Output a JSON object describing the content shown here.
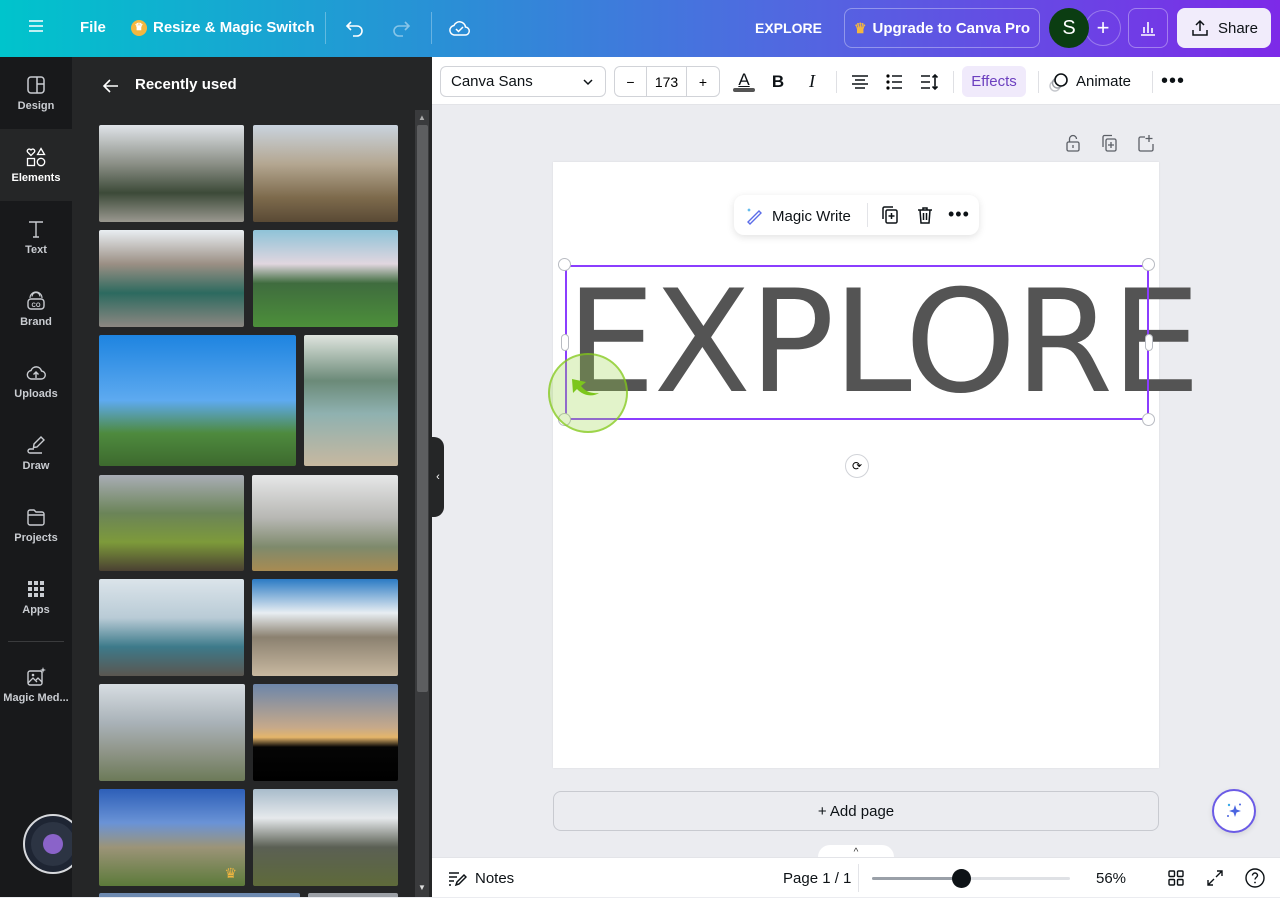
{
  "topbar": {
    "menu_icon": "hamburger-icon",
    "file_label": "File",
    "resize_label": "Resize & Magic Switch",
    "design_title": "EXPLORE",
    "upgrade_label": "Upgrade to Canva Pro",
    "avatar_initial": "S",
    "share_label": "Share",
    "colors": {
      "crown": "#f4b740",
      "avatar_bg": "#0b3d12"
    }
  },
  "rail": {
    "items": [
      {
        "label": "Design",
        "icon": "layout-icon"
      },
      {
        "label": "Elements",
        "icon": "shapes-icon",
        "active": true
      },
      {
        "label": "Text",
        "icon": "text-icon"
      },
      {
        "label": "Brand",
        "icon": "brand-icon"
      },
      {
        "label": "Uploads",
        "icon": "cloud-upload-icon"
      },
      {
        "label": "Draw",
        "icon": "draw-icon"
      },
      {
        "label": "Projects",
        "icon": "folder-icon"
      },
      {
        "label": "Apps",
        "icon": "apps-icon"
      },
      {
        "label": "Magic Med...",
        "icon": "magic-media-icon"
      }
    ]
  },
  "panel": {
    "title": "Recently used",
    "images": [
      {
        "alt": "Hiker in yellow jacket facing snowy mountains and pine trees"
      },
      {
        "alt": "Hiker with trekking pole overlooking rocky mountain valley"
      },
      {
        "alt": "People sitting by a turquoise mountain lake"
      },
      {
        "alt": "Person with open arms facing a volcano over green hills"
      },
      {
        "alt": "Hiker with orange backpack on a rock under blue sky"
      },
      {
        "alt": "Couple sitting on cliff above river canyon"
      },
      {
        "alt": "Couple sitting overlooking green mountain slopes"
      },
      {
        "alt": "Hiker in purple jacket facing misty valley"
      },
      {
        "alt": "Person with binoculars above sea of clouds"
      },
      {
        "alt": "Hiker walking on a dirt road toward snowy peaks"
      },
      {
        "alt": "Person on rocky peak above clouds"
      },
      {
        "alt": "Silhouettes of hikers at sunset"
      },
      {
        "alt": "Group of hikers on rocky trail",
        "premium": true
      },
      {
        "alt": "Hiker with yellow backpack facing snowy mountains"
      }
    ]
  },
  "toolbar": {
    "font_name": "Canva Sans",
    "font_size": "173",
    "decrease_label": "−",
    "increase_label": "+",
    "bold_label": "B",
    "italic_label": "I",
    "effects_label": "Effects",
    "animate_label": "Animate",
    "text_color": "#545454"
  },
  "canvas": {
    "text": "EXPLORE",
    "magic_write_label": "Magic Write",
    "add_page_label": "+ Add page"
  },
  "footer": {
    "notes_label": "Notes",
    "page_indicator": "Page 1 / 1",
    "zoom_label": "56%",
    "zoom_fraction": 0.45
  }
}
